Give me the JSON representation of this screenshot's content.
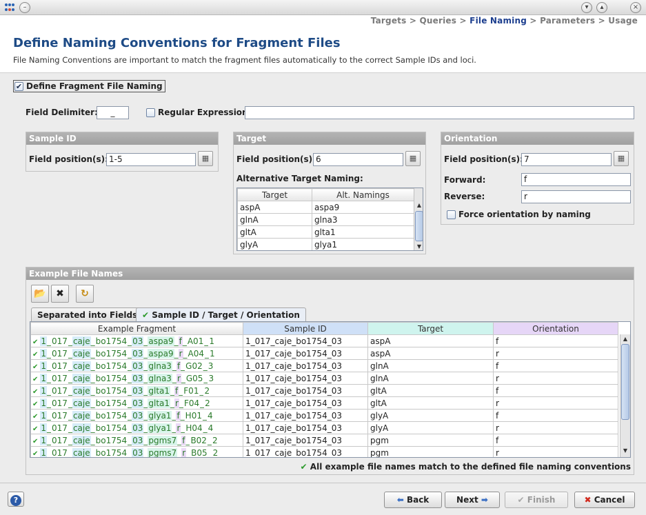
{
  "window": {
    "min_icon": "chevron-down-icon",
    "max_icon": "chevron-up-icon",
    "close_label": "×"
  },
  "breadcrumb": {
    "items": [
      "Targets",
      "Queries",
      "File Naming",
      "Parameters",
      "Usage"
    ],
    "sep": ">",
    "active_index": 2
  },
  "header": {
    "title": "Define Naming Conventions for Fragment Files",
    "subtitle": "File Naming Conventions are important to match the fragment files automatically to the correct Sample IDs and loci."
  },
  "define_naming": {
    "label": "Define Fragment File Naming",
    "checked": true
  },
  "delimiter": {
    "label": "Field Delimiter:",
    "value": "_"
  },
  "regex": {
    "label": "Regular Expression:",
    "checked": false,
    "value": ""
  },
  "sample_id": {
    "title": "Sample ID",
    "pos_label": "Field position(s):",
    "pos_value": "1-5"
  },
  "target": {
    "title": "Target",
    "pos_label": "Field position(s):",
    "pos_value": "6",
    "alt_label": "Alternative Target Naming:",
    "columns": [
      "Target",
      "Alt. Namings"
    ],
    "rows": [
      [
        "aspA",
        "aspa9"
      ],
      [
        "glnA",
        "glna3"
      ],
      [
        "gltA",
        "glta1"
      ],
      [
        "glyA",
        "glya1"
      ]
    ]
  },
  "orientation": {
    "title": "Orientation",
    "pos_label": "Field position(s):",
    "pos_value": "7",
    "fwd_label": "Forward:",
    "fwd_value": "f",
    "rev_label": "Reverse:",
    "rev_value": "r",
    "force_label": "Force orientation by naming",
    "force_checked": false
  },
  "examples": {
    "title": "Example File Names",
    "tabs": [
      "Separated into Fields",
      "Sample ID / Target / Orientation"
    ],
    "active_tab": 1,
    "columns": [
      "Example Fragment",
      "Sample ID",
      "Target",
      "Orientation"
    ],
    "colors": {
      "sample": "#cfe0f7",
      "target": "#cff4ee",
      "orientation": "#e6d6f7",
      "ok": "#2d9a2d"
    },
    "rows": [
      {
        "seg": [
          "1",
          "017",
          "caje",
          "bo1754",
          "03",
          "aspa9",
          "f",
          "A01",
          "1"
        ],
        "sample": "1_017_caje_bo1754_03",
        "target": "aspA",
        "orient": "f"
      },
      {
        "seg": [
          "1",
          "017",
          "caje",
          "bo1754",
          "03",
          "aspa9",
          "r",
          "A04",
          "1"
        ],
        "sample": "1_017_caje_bo1754_03",
        "target": "aspA",
        "orient": "r"
      },
      {
        "seg": [
          "1",
          "017",
          "caje",
          "bo1754",
          "03",
          "glna3",
          "f",
          "G02",
          "3"
        ],
        "sample": "1_017_caje_bo1754_03",
        "target": "glnA",
        "orient": "f"
      },
      {
        "seg": [
          "1",
          "017",
          "caje",
          "bo1754",
          "03",
          "glna3",
          "r",
          "G05",
          "3"
        ],
        "sample": "1_017_caje_bo1754_03",
        "target": "glnA",
        "orient": "r"
      },
      {
        "seg": [
          "1",
          "017",
          "caje",
          "bo1754",
          "03",
          "glta1",
          "f",
          "F01",
          "2"
        ],
        "sample": "1_017_caje_bo1754_03",
        "target": "gltA",
        "orient": "f"
      },
      {
        "seg": [
          "1",
          "017",
          "caje",
          "bo1754",
          "03",
          "glta1",
          "r",
          "F04",
          "2"
        ],
        "sample": "1_017_caje_bo1754_03",
        "target": "gltA",
        "orient": "r"
      },
      {
        "seg": [
          "1",
          "017",
          "caje",
          "bo1754",
          "03",
          "glya1",
          "f",
          "H01",
          "4"
        ],
        "sample": "1_017_caje_bo1754_03",
        "target": "glyA",
        "orient": "f"
      },
      {
        "seg": [
          "1",
          "017",
          "caje",
          "bo1754",
          "03",
          "glya1",
          "r",
          "H04",
          "4"
        ],
        "sample": "1_017_caje_bo1754_03",
        "target": "glyA",
        "orient": "r"
      },
      {
        "seg": [
          "1",
          "017",
          "caje",
          "bo1754",
          "03",
          "pgms7",
          "f",
          "B02",
          "2"
        ],
        "sample": "1_017_caje_bo1754_03",
        "target": "pgm",
        "orient": "f"
      },
      {
        "seg": [
          "1",
          "017",
          "caje",
          "bo1754",
          "03",
          "pgms7",
          "r",
          "B05",
          "2"
        ],
        "sample": "1_017_caje_bo1754_03",
        "target": "pgm",
        "orient": "r"
      }
    ],
    "status": "All example file names match to the defined file naming conventions"
  },
  "footer": {
    "help": "?",
    "back": "Back",
    "next": "Next",
    "finish": "Finish",
    "cancel": "Cancel"
  }
}
